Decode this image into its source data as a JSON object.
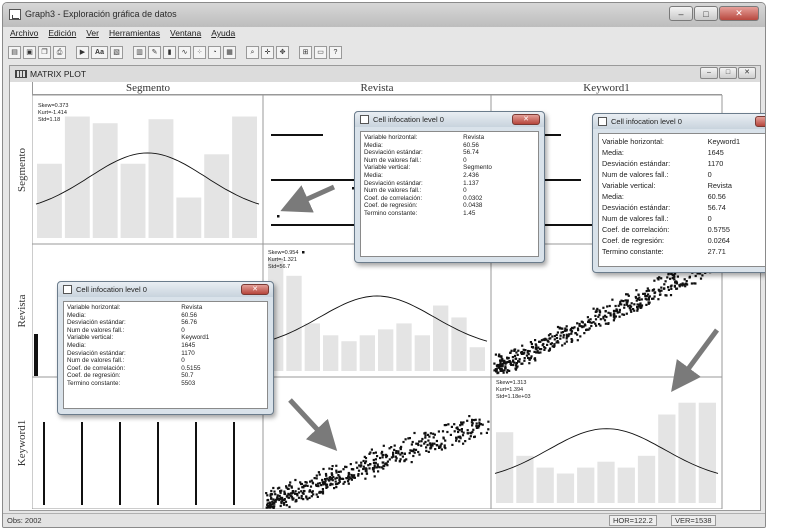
{
  "window": {
    "title": "Graph3 - Exploración gráfica de datos",
    "buttons": {
      "minimize": "–",
      "maximize": "□",
      "close": "✕"
    }
  },
  "menubar": {
    "items": [
      "Archivo",
      "Edición",
      "Ver",
      "Herramientas",
      "Ventana",
      "Ayuda"
    ]
  },
  "toolbar": {
    "buttons": [
      {
        "icon": "open-icon",
        "glyph": "▤"
      },
      {
        "icon": "save-icon",
        "glyph": "▣"
      },
      {
        "icon": "copy-icon",
        "glyph": "❐"
      },
      {
        "icon": "print-icon",
        "glyph": "⎙"
      },
      {
        "icon": "pointer-icon",
        "glyph": "▶"
      },
      {
        "icon": "font-icon",
        "glyph": "Aa"
      },
      {
        "icon": "image-icon",
        "glyph": "▧"
      },
      {
        "icon": "histogram-icon",
        "glyph": "▥"
      },
      {
        "icon": "brush-icon",
        "glyph": "✎"
      },
      {
        "icon": "bar-icon",
        "glyph": "▮"
      },
      {
        "icon": "line-chart-icon",
        "glyph": "∿"
      },
      {
        "icon": "scatter-icon",
        "glyph": "⁘"
      },
      {
        "icon": "pie-icon",
        "glyph": "◔"
      },
      {
        "icon": "table-icon",
        "glyph": "▦"
      },
      {
        "icon": "zoom-icon",
        "glyph": "⌕"
      },
      {
        "icon": "crosshair-icon",
        "glyph": "✛"
      },
      {
        "icon": "move-icon",
        "glyph": "✥"
      },
      {
        "icon": "grid-icon",
        "glyph": "⊞"
      },
      {
        "icon": "frame-icon",
        "glyph": "▭"
      },
      {
        "icon": "help-icon",
        "glyph": "?"
      }
    ]
  },
  "matrix_window": {
    "title": "MATRIX PLOT",
    "columns": [
      "Segmento",
      "Revista",
      "Keyword1"
    ],
    "rows": [
      "Segmento",
      "Revista",
      "Keyword1"
    ]
  },
  "histogram_stats": {
    "segmento": [
      "Skew=0.373",
      "Kurt=-1.414",
      "Std=1.18"
    ],
    "revista": [
      "Skew=0.954",
      "Kurt=-1.321",
      "Std=56.7"
    ],
    "keyword": [
      "Skew=1.313",
      "Kurt=1.394",
      "Std=1.18e+03"
    ]
  },
  "dialog_revista_segmento": {
    "title": "Cell infocation level 0",
    "rows": [
      {
        "k": "Variable horizontal:",
        "v": "Revista"
      },
      {
        "k": "Media:",
        "v": "60.56"
      },
      {
        "k": "Desviación estándar:",
        "v": "56.74"
      },
      {
        "k": "Num de valores fall.:",
        "v": "0"
      },
      {
        "k": "Variable vertical:",
        "v": "Segmento"
      },
      {
        "k": "Media:",
        "v": "2.436"
      },
      {
        "k": "Desviación estándar:",
        "v": "1.137"
      },
      {
        "k": "Num de valores fall.:",
        "v": "0"
      },
      {
        "k": "Coef. de correlación:",
        "v": "0.0302"
      },
      {
        "k": "Coef. de regresión:",
        "v": "0.0438"
      },
      {
        "k": "Termino constante:",
        "v": "1.45"
      }
    ]
  },
  "dialog_keyword_revista": {
    "title": "Cell infocation level 0",
    "rows": [
      {
        "k": "Variable horizontal:",
        "v": "Keyword1"
      },
      {
        "k": "Media:",
        "v": "1645"
      },
      {
        "k": "Desviación estándar:",
        "v": "1170"
      },
      {
        "k": "Num de valores fall.:",
        "v": "0"
      },
      {
        "k": "Variable vertical:",
        "v": "Revista"
      },
      {
        "k": "Media:",
        "v": "60.56"
      },
      {
        "k": "Desviación estándar:",
        "v": "56.74"
      },
      {
        "k": "Num de valores fall.:",
        "v": "0"
      },
      {
        "k": "Coef. de correlación:",
        "v": "0.5755"
      },
      {
        "k": "Coef. de regresión:",
        "v": "0.0264"
      },
      {
        "k": "Termino constante:",
        "v": "27.71"
      }
    ]
  },
  "dialog_revista_keyword": {
    "title": "Cell infocation level 0",
    "rows": [
      {
        "k": "Variable horizontal:",
        "v": "Revista"
      },
      {
        "k": "Media:",
        "v": "60.56"
      },
      {
        "k": "Desviación estándar:",
        "v": "56.76"
      },
      {
        "k": "Num de valores fall.:",
        "v": "0"
      },
      {
        "k": "Variable vertical:",
        "v": "Keyword1"
      },
      {
        "k": "Media:",
        "v": "1645"
      },
      {
        "k": "Desviación estándar:",
        "v": "1170"
      },
      {
        "k": "Num de valores fall.:",
        "v": "0"
      },
      {
        "k": "Coef. de correlación:",
        "v": "0.5155"
      },
      {
        "k": "Coef. de regresión:",
        "v": "50.7"
      },
      {
        "k": "Termino constante:",
        "v": "5503"
      }
    ]
  },
  "statusbar": {
    "left": "Obs: 2002",
    "hor": "HOR=122.2",
    "ver": "VER=1538"
  },
  "colors": {
    "arrow": "#7a7a7a",
    "histogram_bar": "#e4e4e4",
    "scatter_point": "#111111"
  }
}
